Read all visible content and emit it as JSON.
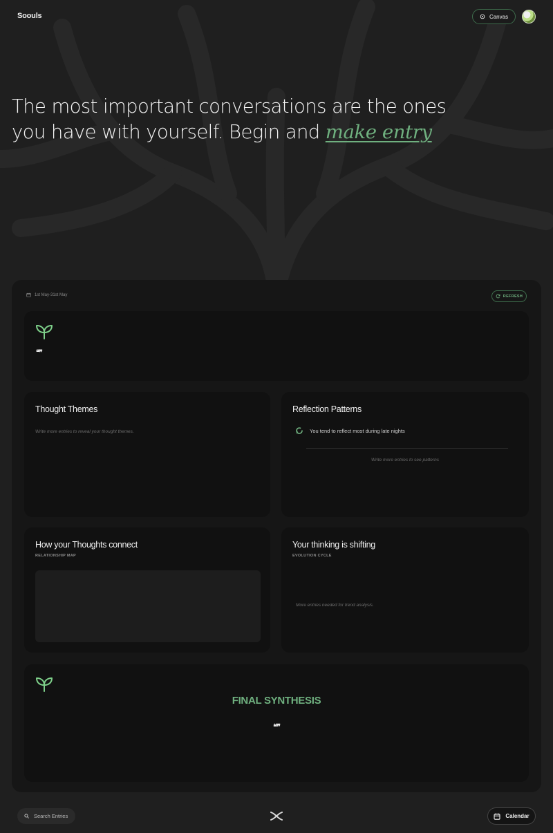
{
  "app": {
    "brand": "Soouls"
  },
  "header": {
    "canvas_label": "Canvas"
  },
  "hero": {
    "line1": "The most important conversations are the ones",
    "line2_prefix": "you have with yourself. Begin and ",
    "cta": "make entry"
  },
  "dashboard": {
    "date_range": "1st May-31st May",
    "refresh_label": "REFRESH",
    "quote_card": {
      "quote_mark": "❝❞"
    },
    "thought_themes": {
      "title": "Thought Themes",
      "empty": "Write more entries to reveal your thought themes."
    },
    "reflection_patterns": {
      "title": "Reflection Patterns",
      "pattern": "You tend to reflect most during late nights",
      "empty": "Write more entries to see patterns"
    },
    "thoughts_connect": {
      "title": "How your Thoughts connect",
      "subtitle": "RELATIONSHIP MAP"
    },
    "thinking_shift": {
      "title": "Your thinking is shifting",
      "subtitle": "EVOLUTION CYCLE",
      "empty": "More entries needed for trend analysis."
    },
    "final_synthesis": {
      "title": "FINAL SYNTHESIS",
      "quote_mark": "❝❞"
    }
  },
  "footer": {
    "search_placeholder": "Search Entries",
    "calendar_label": "Calendar"
  },
  "colors": {
    "accent_green": "#6fb07f",
    "background": "#1f1f1f",
    "panel": "#161616",
    "card": "#111111"
  }
}
